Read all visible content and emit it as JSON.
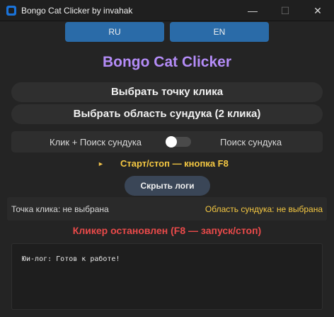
{
  "window": {
    "title": "Bongo Cat Clicker by invahak",
    "minimize_glyph": "—",
    "maximize_glyph": "☐",
    "close_glyph": "✕"
  },
  "language": {
    "ru_label": "RU",
    "en_label": "EN"
  },
  "app": {
    "title": "Bongo Cat Clicker",
    "title_color": "#b48cf7"
  },
  "actions": {
    "select_point_label": "Выбрать точку клика",
    "select_chest_label": "Выбрать область сундука (2 клика)"
  },
  "mode_toggle": {
    "left_label": "Клик + Поиск сундука",
    "right_label": "Поиск сундука",
    "state": "off"
  },
  "hotkey": {
    "arrow_glyph": "►",
    "label": "Старт/стоп — кнопка F8",
    "color": "#f5c842"
  },
  "logs_button": {
    "label": "Скрыть логи"
  },
  "status": {
    "point_text": "Точка клика: не выбрана",
    "chest_text": "Область сундука: не выбрана",
    "chest_color": "#f5c842"
  },
  "clicker_state": {
    "text": "Кликер остановлен (F8 — запуск/стоп)",
    "color": "#ea4a4a"
  },
  "log": {
    "lines": [
      "Юи-лог: Готов к работе!"
    ]
  },
  "colors": {
    "accent_button": "#2a6ba8",
    "background": "#242424"
  }
}
